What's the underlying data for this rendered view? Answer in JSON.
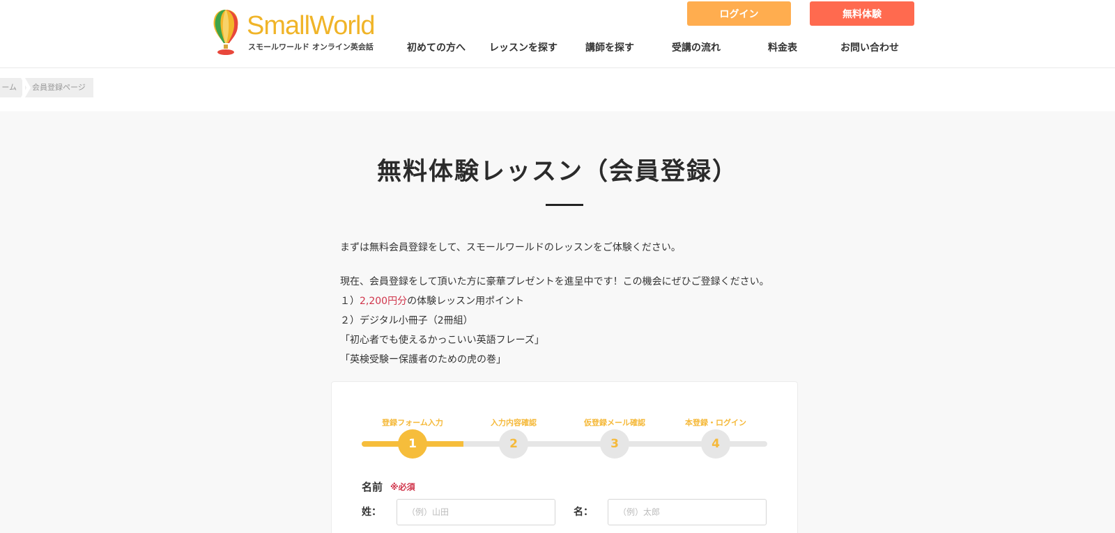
{
  "header": {
    "logo_text": "SmallWorld",
    "logo_subtitle": "スモールワールド オンライン英会話",
    "login_label": "ログイン",
    "trial_label": "無料体験",
    "nav": [
      "初めての方へ",
      "レッスンを探す",
      "講師を探す",
      "受講の流れ",
      "料金表",
      "お問い合わせ"
    ]
  },
  "breadcrumb": {
    "home": "ーム",
    "current": "会員登録ページ"
  },
  "page": {
    "title": "無料体験レッスン（会員登録）",
    "intro_1": "まずは無料会員登録をして、スモールワールドのレッスンをご体験ください。",
    "intro_2": "現在、会員登録をして頂いた方に豪華プレゼントを進呈中です！この機会にぜひご登録ください。",
    "item1_prefix": "１）",
    "item1_highlight": "2,200円分",
    "item1_suffix": "の体験レッスン用ポイント",
    "item2": "２）デジタル小冊子（2冊組）",
    "item3": "「初心者でも使えるかっこいい英語フレーズ」",
    "item4": "「英検受験ー保護者のための虎の巻」"
  },
  "steps": [
    {
      "label": "登録フォーム入力",
      "number": "1"
    },
    {
      "label": "入力内容確認",
      "number": "2"
    },
    {
      "label": "仮登録メール確認",
      "number": "3"
    },
    {
      "label": "本登録・ログイン",
      "number": "4"
    }
  ],
  "form": {
    "name_title": "名前",
    "required": "※必須",
    "last_label": "姓：",
    "last_placeholder": "（例）山田",
    "first_label": "名：",
    "first_placeholder": "（例）太郎"
  },
  "colors": {
    "accent_yellow": "#f6bd3b",
    "login_orange": "#ffad4f",
    "trial_red": "#ff6a4f",
    "highlight": "#d0344a"
  }
}
